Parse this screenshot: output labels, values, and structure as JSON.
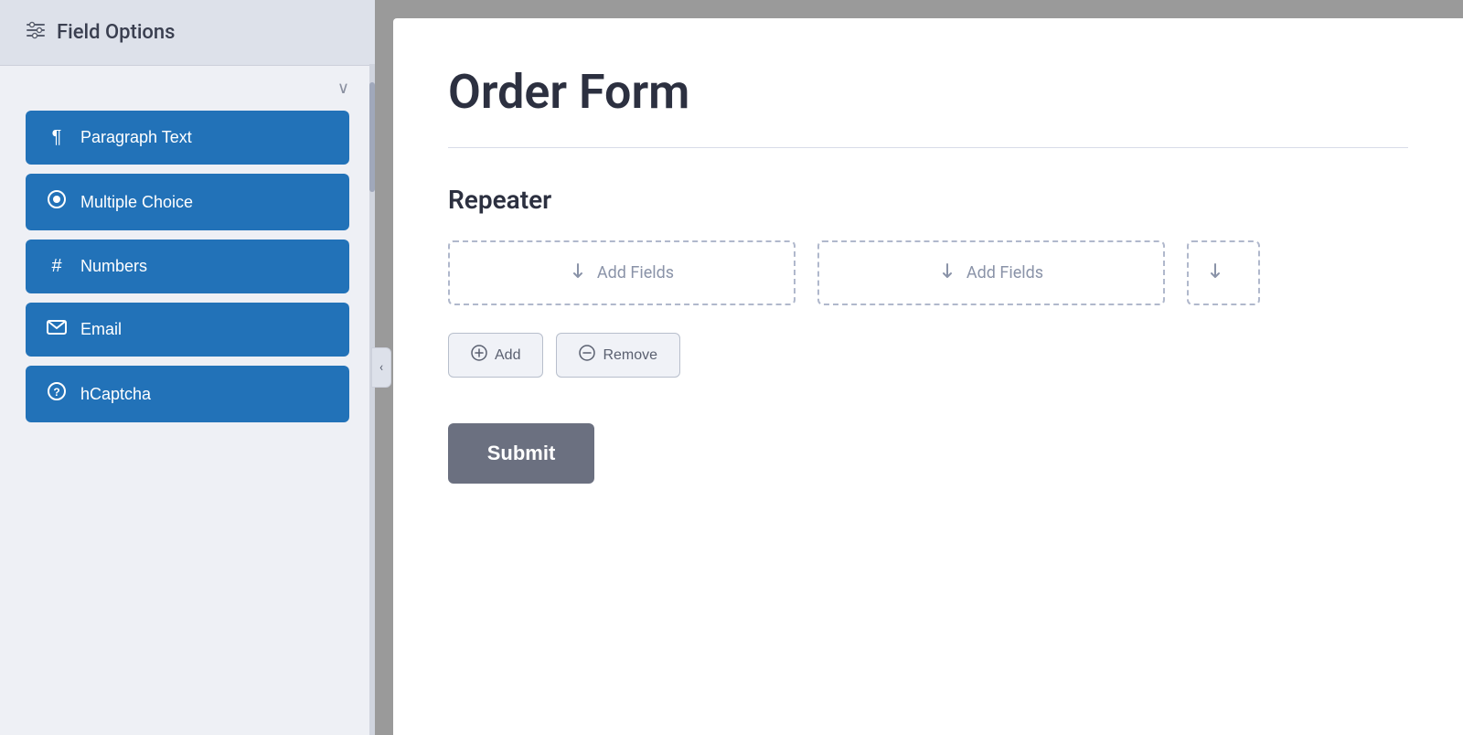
{
  "sidebar": {
    "header": {
      "icon": "≡",
      "title": "Field Options"
    },
    "chevron": "∨",
    "items": [
      {
        "id": "paragraph-text",
        "icon": "¶",
        "label": "Paragraph Text"
      },
      {
        "id": "multiple-choice",
        "icon": "◎",
        "label": "Multiple Choice"
      },
      {
        "id": "numbers",
        "icon": "#",
        "label": "Numbers"
      },
      {
        "id": "email",
        "icon": "✉",
        "label": "Email"
      },
      {
        "id": "hcaptcha",
        "icon": "?",
        "label": "hCaptcha"
      }
    ],
    "collapse_icon": "‹"
  },
  "form": {
    "title": "Order Form",
    "section_title": "Repeater",
    "add_fields_label": "Add Fields",
    "add_button_label": "Add",
    "remove_button_label": "Remove",
    "submit_label": "Submit"
  }
}
